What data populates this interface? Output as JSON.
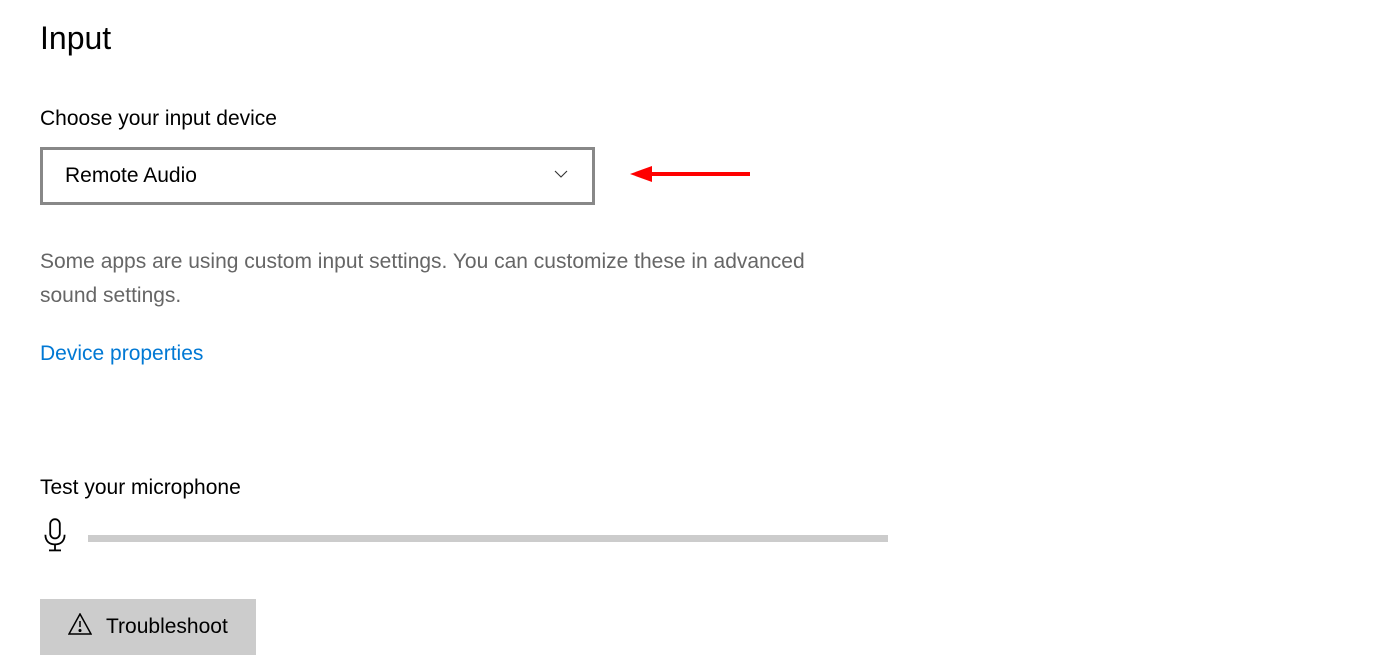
{
  "section": {
    "title": "Input"
  },
  "input_device": {
    "label": "Choose your input device",
    "selected": "Remote Audio"
  },
  "info": {
    "text": "Some apps are using custom input settings. You can customize these in advanced sound settings."
  },
  "link": {
    "device_properties": "Device properties"
  },
  "mic_test": {
    "label": "Test your microphone"
  },
  "button": {
    "troubleshoot": "Troubleshoot"
  }
}
